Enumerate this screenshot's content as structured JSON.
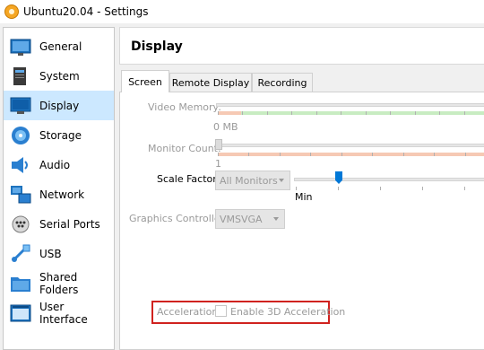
{
  "window": {
    "title": "Ubuntu20.04 - Settings"
  },
  "sidebar": {
    "items": [
      {
        "label": "General",
        "icon": "general-icon"
      },
      {
        "label": "System",
        "icon": "system-icon"
      },
      {
        "label": "Display",
        "icon": "display-icon",
        "selected": true
      },
      {
        "label": "Storage",
        "icon": "storage-icon"
      },
      {
        "label": "Audio",
        "icon": "audio-icon"
      },
      {
        "label": "Network",
        "icon": "network-icon"
      },
      {
        "label": "Serial Ports",
        "icon": "serial-ports-icon"
      },
      {
        "label": "USB",
        "icon": "usb-icon"
      },
      {
        "label": "Shared Folders",
        "icon": "shared-folders-icon"
      },
      {
        "label": "User Interface",
        "icon": "user-interface-icon"
      }
    ]
  },
  "page": {
    "title": "Display",
    "tabs": [
      {
        "label": "Screen",
        "active": true
      },
      {
        "label": "Remote Display"
      },
      {
        "label": "Recording"
      }
    ]
  },
  "screen": {
    "video_memory": {
      "label": "Video Memory:",
      "min_label": "0 MB"
    },
    "monitor_count": {
      "label": "Monitor Count:",
      "min_label": "1"
    },
    "scale_factor": {
      "label": "Scale Factor:",
      "combo_value": "All Monitors",
      "min_label": "Min"
    },
    "graphics_controller": {
      "label": "Graphics Controller:",
      "value": "VMSVGA"
    },
    "acceleration": {
      "label": "Acceleration:",
      "checkbox_label": "Enable 3D Acceleration",
      "checked": false
    }
  },
  "colors": {
    "accent": "#0078d7",
    "selection": "#cce8ff",
    "highlight_box": "#d0221f"
  }
}
